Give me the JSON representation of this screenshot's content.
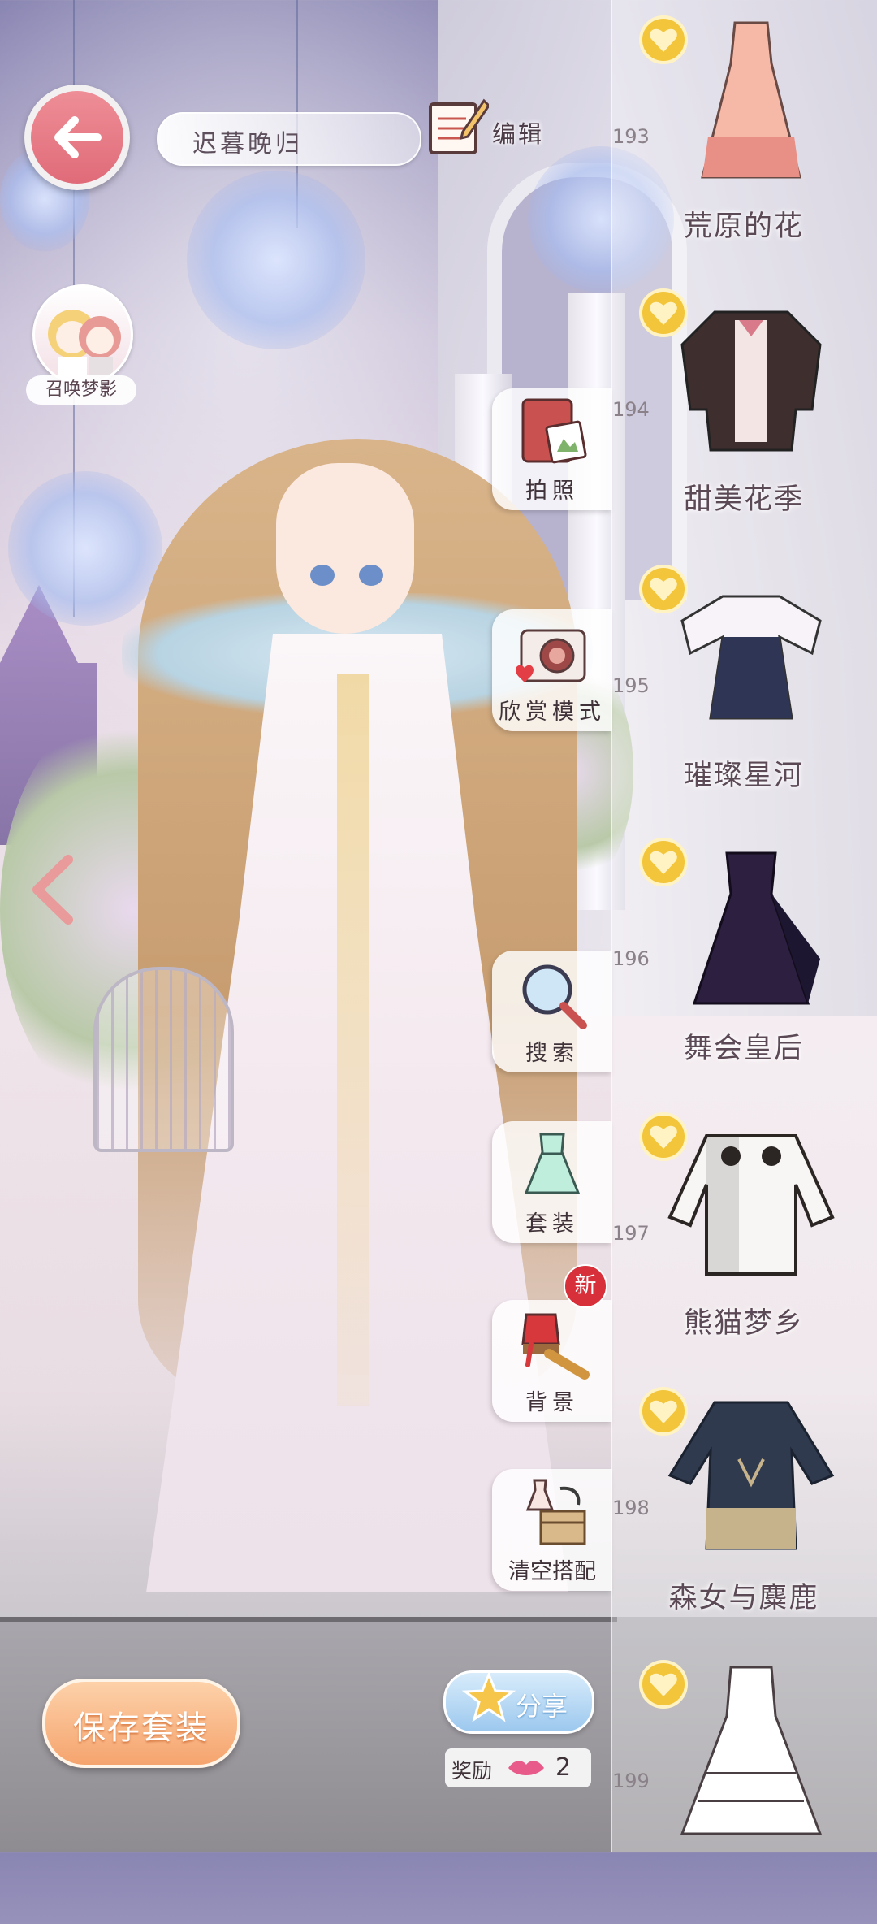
{
  "header": {
    "outfit_name": "迟暮晚归",
    "edit_label": "编辑"
  },
  "summon": {
    "label": "召唤梦影"
  },
  "side_menu": [
    {
      "id": "photo",
      "label": "拍照"
    },
    {
      "id": "appreciate",
      "label": "欣赏模式"
    },
    {
      "id": "search",
      "label": "搜索"
    },
    {
      "id": "suit",
      "label": "套装"
    },
    {
      "id": "background",
      "label": "背景"
    },
    {
      "id": "clear",
      "label": "清空搭配"
    }
  ],
  "new_badge": "新",
  "items": [
    {
      "num": "193",
      "name": "荒原的花",
      "colors": [
        "#f6b9a8",
        "#e88f86"
      ]
    },
    {
      "num": "194",
      "name": "甜美花季",
      "colors": [
        "#3e2e2e",
        "#f3e5e3"
      ]
    },
    {
      "num": "195",
      "name": "璀璨星河",
      "colors": [
        "#2e3555",
        "#f7f3f8"
      ]
    },
    {
      "num": "196",
      "name": "舞会皇后",
      "colors": [
        "#2c1f3f",
        "#1d1630"
      ]
    },
    {
      "num": "197",
      "name": "熊猫梦乡",
      "colors": [
        "#2b2524",
        "#f8f6f5"
      ]
    },
    {
      "num": "198",
      "name": "森女与麋鹿",
      "colors": [
        "#2f3a4f",
        "#c7b38b"
      ]
    },
    {
      "num": "199",
      "name": "",
      "colors": [
        "#ffffff",
        "#e9e4e6"
      ]
    }
  ],
  "bottom": {
    "save_label": "保存套装",
    "share_label": "分享",
    "reward_label": "奖励",
    "reward_count": "2"
  },
  "colors": {
    "back_button": "#e06b79",
    "save_button": "#f5a46e",
    "share_button": "#9cc8ee",
    "heart_badge": "#f2c53a",
    "new_badge": "#d8303b"
  }
}
